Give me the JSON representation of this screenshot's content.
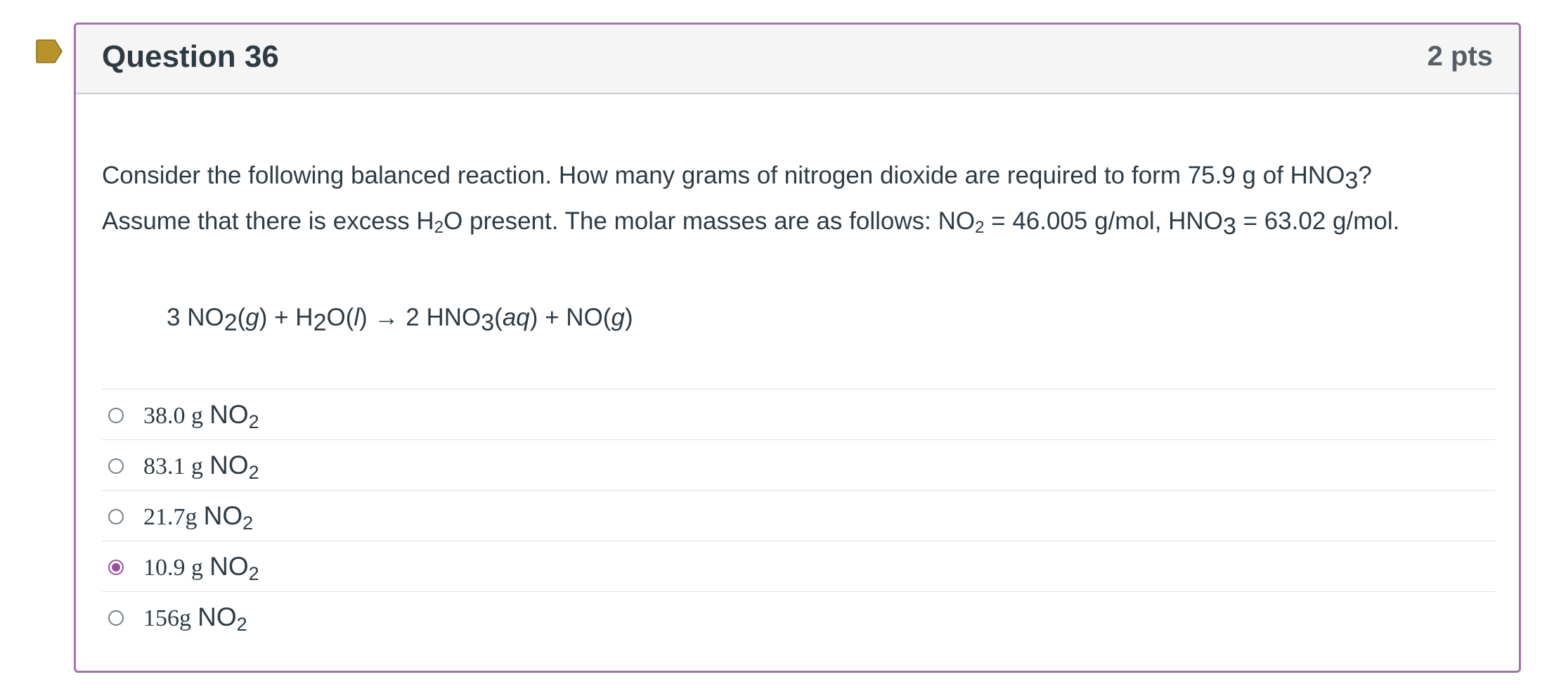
{
  "question": {
    "title": "Question 36",
    "points": "2 pts",
    "flag_icon": "flag-icon",
    "accent_color": "#a671ad",
    "selected_color": "#9b4f9f",
    "flag_color": "#b8922a"
  },
  "prompt": {
    "line1_part1": "Consider the following balanced reaction. How many grams of nitrogen dioxide are required to form 75.9 g of HNO",
    "line1_sub1": "3",
    "line1_part2": "?",
    "line2_part1": "Assume that there is excess H",
    "line2_sub1": "2",
    "line2_part2": "O present. The molar masses are as follows: NO",
    "line2_sub2": "2",
    "line2_part3": " = 46.005 g/mol, HNO",
    "line2_sub3": "3",
    "line2_part4": " = 63.02 g/mol."
  },
  "reaction": {
    "t1": "3 NO",
    "s1": "2",
    "t2": "(",
    "i1": "g",
    "t3": ") + H",
    "s2": "2",
    "t4": "O(",
    "i2": "l",
    "t5": ") → 2 HNO",
    "s3": "3",
    "t6": "(",
    "i3": "aq",
    "t7": ") + NO(",
    "i4": "g",
    "t8": ")"
  },
  "answers": [
    {
      "value": "38.0 g",
      "chem": "NO",
      "sub": "2",
      "selected": false
    },
    {
      "value": "83.1 g",
      "chem": "NO",
      "sub": "2",
      "selected": false
    },
    {
      "value": "21.7g",
      "chem": "NO",
      "sub": "2",
      "selected": false
    },
    {
      "value": "10.9 g",
      "chem": "NO",
      "sub": "2",
      "selected": true
    },
    {
      "value": "156g",
      "chem": "NO",
      "sub": "2",
      "selected": false
    }
  ]
}
